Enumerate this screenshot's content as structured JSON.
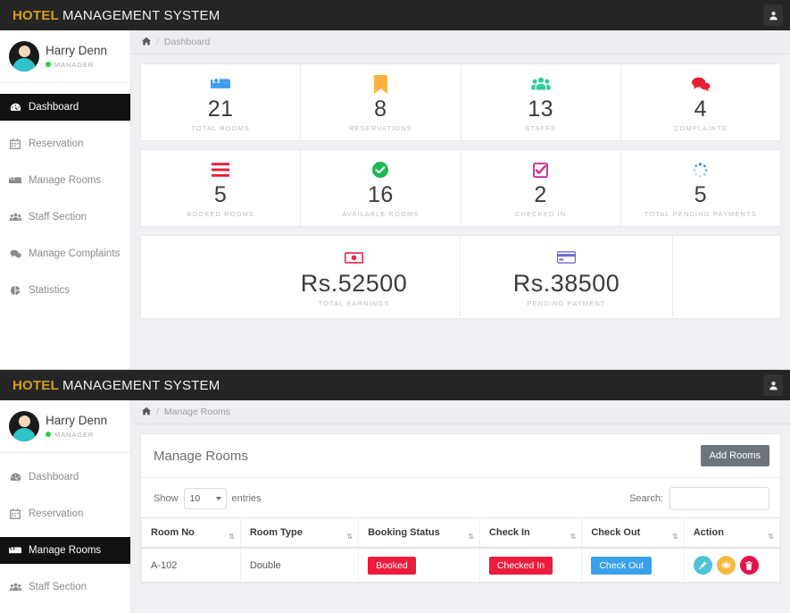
{
  "brand": {
    "part1": "HOTEL",
    "part2": "MANAGEMENT SYSTEM"
  },
  "profile": {
    "name": "Harry Denn",
    "role": "MANAGER"
  },
  "sidebar": {
    "items": [
      {
        "label": "Dashboard",
        "icon": "dashboard-icon"
      },
      {
        "label": "Reservation",
        "icon": "calendar-icon"
      },
      {
        "label": "Manage Rooms",
        "icon": "bed-icon"
      },
      {
        "label": "Staff Section",
        "icon": "users-icon"
      },
      {
        "label": "Manage Complaints",
        "icon": "comments-icon"
      },
      {
        "label": "Statistics",
        "icon": "pie-chart-icon"
      }
    ]
  },
  "screen_dashboard": {
    "breadcrumb": {
      "home": "",
      "sep": "/",
      "current": "Dashboard"
    },
    "stats_row1": [
      {
        "value": "21",
        "label": "TOTAL ROOMS",
        "icon": "bed-icon",
        "color": "#3d9df3"
      },
      {
        "value": "8",
        "label": "RESERVATIONS",
        "icon": "bookmark-icon",
        "color": "#fbb040"
      },
      {
        "value": "13",
        "label": "STAFFS",
        "icon": "users-icon",
        "color": "#2ecc9e"
      },
      {
        "value": "4",
        "label": "COMPLAINTS",
        "icon": "comments-icon",
        "color": "#ed1c35"
      }
    ],
    "stats_row2": [
      {
        "value": "5",
        "label": "BOOKED ROOMS",
        "icon": "bars-icon",
        "color": "#ed1c35"
      },
      {
        "value": "16",
        "label": "AVAILABLE ROOMS",
        "icon": "check-circle-icon",
        "color": "#1db954"
      },
      {
        "value": "2",
        "label": "CHECKED IN",
        "icon": "check-square-icon",
        "color": "#cc3399"
      },
      {
        "value": "5",
        "label": "TOTAL PENDING PAYMENTS",
        "icon": "spinner-icon",
        "color": "#2f86e0"
      }
    ],
    "stats_row3": [
      {
        "value": "Rs.52500",
        "label": "TOTAL EARNINGS",
        "icon": "money-bill-icon",
        "color": "#f0264a"
      },
      {
        "value": "Rs.38500",
        "label": "PENDING PAYMENT",
        "icon": "credit-card-icon",
        "color": "#6a6ad4"
      }
    ]
  },
  "screen_rooms": {
    "breadcrumb": {
      "home": "",
      "sep": "/",
      "current": "Manage Rooms"
    },
    "card_title": "Manage Rooms",
    "add_button": "Add Rooms",
    "show_label": "Show",
    "entries_label": "entries",
    "entries_value": "10",
    "search_label": "Search:",
    "search_value": "",
    "search_placeholder": "",
    "columns": [
      "Room No",
      "Room Type",
      "Booking Status",
      "Check In",
      "Check Out",
      "Action"
    ],
    "rows": [
      {
        "room_no": "A-102",
        "room_type": "Double",
        "booking_status": {
          "text": "Booked",
          "color": "#ec1c3d"
        },
        "check_in": {
          "text": "Checked In",
          "color": "#ec1c3d"
        },
        "check_out": {
          "text": "Check Out",
          "color": "#3aa0ec"
        },
        "actions": [
          {
            "name": "edit-button",
            "icon": "pencil-icon",
            "color": "#4dc3d6"
          },
          {
            "name": "view-button",
            "icon": "eye-icon",
            "color": "#f5b942"
          },
          {
            "name": "delete-button",
            "icon": "trash-icon",
            "color": "#e3144a"
          }
        ]
      }
    ]
  }
}
